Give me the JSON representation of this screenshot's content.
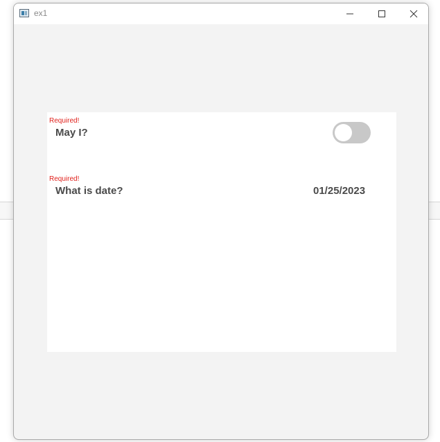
{
  "window": {
    "title": "ex1"
  },
  "form": {
    "fields": [
      {
        "required_text": "Required!",
        "label": "May I?",
        "control": "toggle",
        "toggle_on": false
      },
      {
        "required_text": "Required!",
        "label": "What is date?",
        "control": "date",
        "value": "01/25/2023"
      }
    ]
  },
  "colors": {
    "required": "#e0201b",
    "label": "#4a4a4a",
    "toggle_track": "#c8c8c8",
    "window_bg": "#f3f3f3"
  }
}
